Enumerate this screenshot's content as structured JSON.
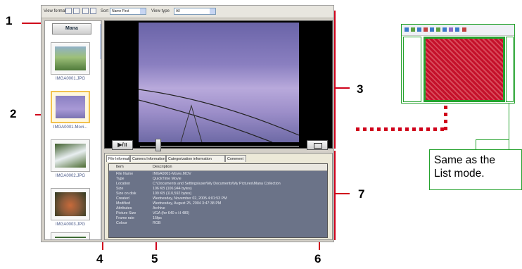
{
  "callouts": [
    "1",
    "2",
    "3",
    "4",
    "5",
    "6",
    "7"
  ],
  "toolbar": {
    "view_format_label": "View format",
    "sort_label": "Sort",
    "sort_value": "Name First",
    "view_type_label": "View type",
    "view_type_value": "All"
  },
  "sidebar": {
    "mana_button": "Mana",
    "thumbs": [
      {
        "label": "IMGA0001.JPG"
      },
      {
        "label": "IMGA0001-Movi..."
      },
      {
        "label": "IMGA0002.JPG"
      },
      {
        "label": "IMGA0003.JPG"
      }
    ]
  },
  "viewer": {
    "play_pause_label": "▶/॥",
    "fullscreen_icon": "fullscreen-icon"
  },
  "info": {
    "tabs": [
      "File Information",
      "Camera Information",
      "Categorization information",
      "Comment"
    ],
    "header": {
      "item": "Item",
      "description": "Description"
    },
    "rows": [
      {
        "k": "File Name",
        "v": "IMGA0001-Movie.MOV"
      },
      {
        "k": "Type",
        "v": "QuickTime Movie"
      },
      {
        "k": "Location",
        "v": "C:\\Documents and Settings\\user\\My Documents\\My Pictures\\Mana Collection"
      },
      {
        "k": "Size",
        "v": "106 KB (106,944 bytes)"
      },
      {
        "k": "Size on disk",
        "v": "109 KB (110,592 bytes)"
      },
      {
        "k": "Created",
        "v": "Wednesday, November 02, 2005 4:01:53 PM"
      },
      {
        "k": "Modified",
        "v": "Wednesday, August 25, 2004 3:47:38 PM"
      },
      {
        "k": "Attributes",
        "v": "Archive"
      },
      {
        "k": "Picture Size",
        "v": "VGA (for 640 x H 480)"
      },
      {
        "k": "Frame rate",
        "v": "15fps"
      },
      {
        "k": "Colour",
        "v": "RGB"
      }
    ]
  },
  "note": {
    "line1": "Same as the",
    "line2": "List mode."
  },
  "colors": {
    "callout_red": "#d0021b",
    "highlight_green": "#25a22e"
  }
}
